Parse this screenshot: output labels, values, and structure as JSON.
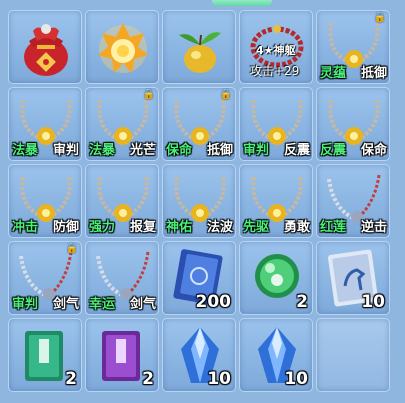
{
  "slots": [
    {
      "icon": "lucky-bag-icon"
    },
    {
      "icon": "golden-flame-orb-icon"
    },
    {
      "icon": "golden-fruit-icon"
    },
    {
      "icon": "red-bead-bracelet-icon",
      "badge": "4★神躯",
      "stat": "攻击+29"
    },
    {
      "icon": "bead-necklace-icon",
      "lock": "🔒",
      "tag_a": "灵蕴",
      "tag_b": "抵御"
    },
    {
      "icon": "bead-necklace-icon",
      "tag_a": "法暴",
      "tag_b": "审判"
    },
    {
      "icon": "bead-necklace-icon",
      "lock": "🔒",
      "tag_a": "法暴",
      "tag_b": "光芒"
    },
    {
      "icon": "bead-necklace-icon",
      "lock": "🔒",
      "tag_a": "保命",
      "tag_b": "抵御"
    },
    {
      "icon": "bead-necklace-icon",
      "tag_a": "审判",
      "tag_b": "反震"
    },
    {
      "icon": "bead-necklace-icon",
      "tag_a": "反震",
      "tag_b": "保命"
    },
    {
      "icon": "bead-necklace-icon",
      "tag_a": "冲击",
      "tag_b": "防御"
    },
    {
      "icon": "bead-necklace-icon",
      "tag_a": "强力",
      "tag_b": "报复"
    },
    {
      "icon": "bead-necklace-icon",
      "tag_a": "神佑",
      "tag_b": "法波"
    },
    {
      "icon": "bead-necklace-icon",
      "tag_a": "先驱",
      "tag_b": "勇敢"
    },
    {
      "icon": "silver-necklace-icon",
      "tag_a": "红莲",
      "tag_b": "逆击"
    },
    {
      "icon": "silver-necklace-icon",
      "lock": "🔒",
      "tag_a": "审判",
      "tag_b": "剑气"
    },
    {
      "icon": "silver-necklace-icon",
      "tag_a": "幸运",
      "tag_b": "剑气"
    },
    {
      "icon": "blue-spellbook-icon",
      "qty": "200"
    },
    {
      "icon": "green-pet-orb-icon",
      "qty": "2"
    },
    {
      "icon": "horse-manual-book-icon",
      "qty": "10"
    },
    {
      "icon": "green-book-icon",
      "qty": "2"
    },
    {
      "icon": "purple-book-icon",
      "qty": "2"
    },
    {
      "icon": "blue-crystal-icon",
      "qty": "10"
    },
    {
      "icon": "blue-crystal-icon",
      "qty": "10"
    },
    {
      "icon": "empty-slot"
    }
  ]
}
